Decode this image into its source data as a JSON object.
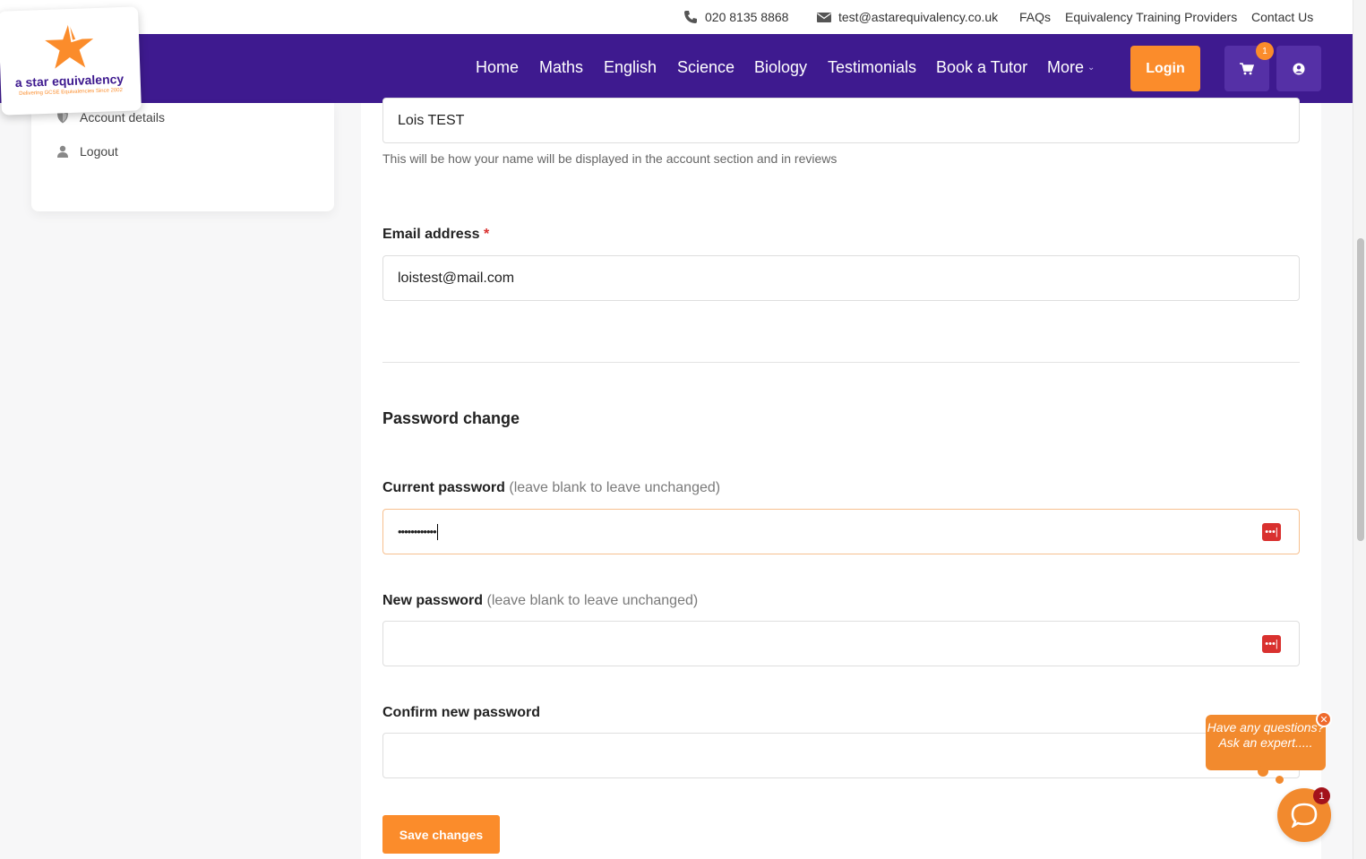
{
  "topbar": {
    "phone": "020 8135 8868",
    "email": "test@astarequivalency.co.uk",
    "links": [
      "FAQs",
      "Equivalency Training Providers",
      "Contact Us"
    ]
  },
  "logo": {
    "name": "a star equivalency",
    "tagline": "Delivering GCSE Equivalencies Since 2002"
  },
  "nav": {
    "links": [
      "Home",
      "Maths",
      "English",
      "Science",
      "Biology",
      "Testimonials",
      "Book a Tutor",
      "More"
    ],
    "login_label": "Login",
    "cart_count": "1"
  },
  "sidebar": {
    "items": [
      {
        "label": "Account details",
        "icon": "shield-icon"
      },
      {
        "label": "Logout",
        "icon": "user-icon"
      }
    ]
  },
  "form": {
    "display_name_value": "Lois TEST",
    "display_name_help": "This will be how your name will be displayed in the account section and in reviews",
    "email_label": "Email address",
    "email_required": "*",
    "email_value": "loistest@mail.com",
    "password_section_title": "Password change",
    "current_password_label": "Current password",
    "current_password_hint": "(leave blank to leave unchanged)",
    "current_password_value": "••••••••••••",
    "new_password_label": "New password",
    "new_password_hint": "(leave blank to leave unchanged)",
    "confirm_password_label": "Confirm new password",
    "save_label": "Save changes"
  },
  "chat": {
    "prompt": "Have any questions? Ask an expert.....",
    "close": "✕",
    "badge": "1"
  },
  "colors": {
    "brand_purple": "#3e1a8f",
    "accent_orange": "#fb8c2b",
    "password_manager_red": "#d9312f"
  }
}
